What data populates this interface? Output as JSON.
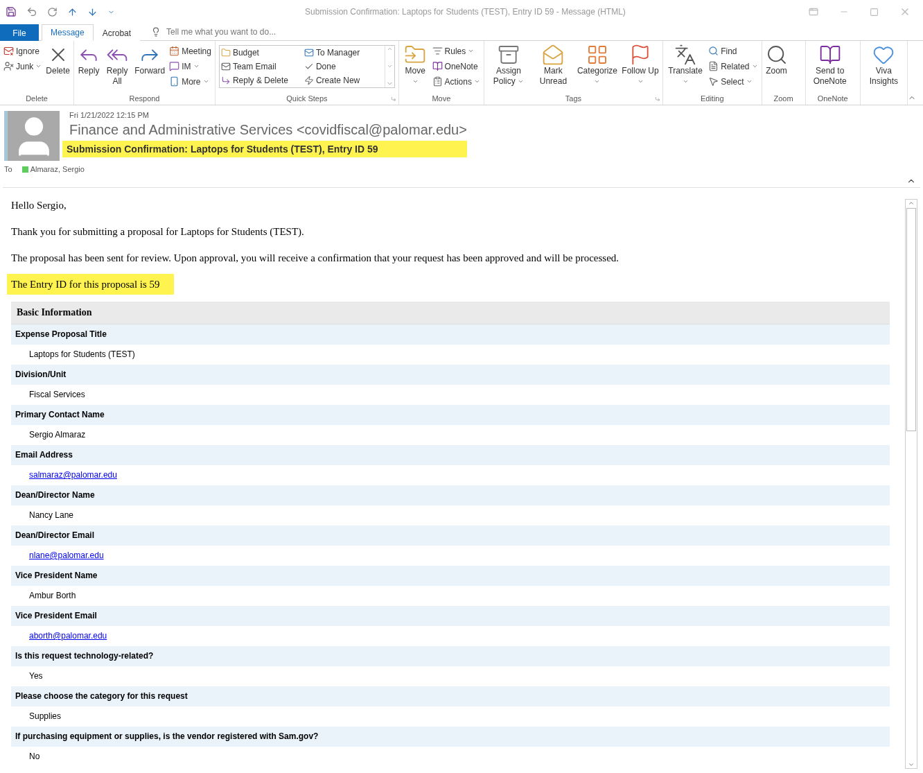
{
  "window": {
    "title": "Submission Confirmation: Laptops for Students (TEST), Entry ID 59 - Message (HTML)"
  },
  "tabs": [
    {
      "label": "File",
      "kind": "file",
      "selected": false
    },
    {
      "label": "Message",
      "kind": "tab",
      "selected": true
    },
    {
      "label": "Acrobat",
      "kind": "tab",
      "selected": false
    }
  ],
  "tell_me": {
    "placeholder": "Tell me what you want to do..."
  },
  "ribbon": {
    "groups": [
      {
        "label": "Delete",
        "launcher": false,
        "columns": [
          {
            "kind": "stack",
            "items": [
              {
                "label": "Ignore",
                "dropdown": false
              },
              {
                "label": "Junk",
                "dropdown": true
              }
            ]
          },
          {
            "kind": "large",
            "label": "Delete",
            "dropdown": false
          }
        ]
      },
      {
        "label": "Respond",
        "launcher": false,
        "columns": [
          {
            "kind": "large",
            "label": "Reply",
            "dropdown": false
          },
          {
            "kind": "large",
            "label": "Reply All",
            "dropdown": false
          },
          {
            "kind": "large",
            "label": "Forward",
            "dropdown": false
          },
          {
            "kind": "stack",
            "items": [
              {
                "label": "Meeting",
                "dropdown": false
              },
              {
                "label": "IM",
                "dropdown": true
              },
              {
                "label": "More",
                "dropdown": true
              }
            ]
          }
        ]
      },
      {
        "label": "Quick Steps",
        "launcher": true,
        "columns": [
          {
            "kind": "gallery",
            "items": [
              {
                "label": "Budget",
                "dropdown": false
              },
              {
                "label": "Team Email",
                "dropdown": false
              },
              {
                "label": "Reply & Delete",
                "dropdown": false
              },
              {
                "label": "To Manager",
                "dropdown": false
              },
              {
                "label": "Done",
                "dropdown": false
              },
              {
                "label": "Create New",
                "dropdown": false
              }
            ]
          }
        ]
      },
      {
        "label": "Move",
        "launcher": false,
        "columns": [
          {
            "kind": "large",
            "label": "Move",
            "dropdown": true
          },
          {
            "kind": "stack",
            "items": [
              {
                "label": "Rules",
                "dropdown": true
              },
              {
                "label": "OneNote",
                "dropdown": false
              },
              {
                "label": "Actions",
                "dropdown": true
              }
            ]
          }
        ]
      },
      {
        "label": "Tags",
        "launcher": true,
        "columns": [
          {
            "kind": "large",
            "label": "Assign Policy",
            "dropdown": true
          },
          {
            "kind": "large",
            "label": "Mark Unread",
            "dropdown": false
          },
          {
            "kind": "large",
            "label": "Categorize",
            "dropdown": true
          },
          {
            "kind": "large",
            "label": "Follow Up",
            "dropdown": true
          }
        ]
      },
      {
        "label": "Editing",
        "launcher": false,
        "columns": [
          {
            "kind": "large",
            "label": "Translate",
            "dropdown": true
          },
          {
            "kind": "stack",
            "items": [
              {
                "label": "Find",
                "dropdown": false
              },
              {
                "label": "Related",
                "dropdown": true
              },
              {
                "label": "Select",
                "dropdown": true
              }
            ]
          }
        ]
      },
      {
        "label": "Zoom",
        "launcher": false,
        "columns": [
          {
            "kind": "large",
            "label": "Zoom",
            "dropdown": false
          }
        ]
      },
      {
        "label": "OneNote",
        "launcher": false,
        "columns": [
          {
            "kind": "large",
            "label": "Send to OneNote",
            "dropdown": false
          }
        ]
      },
      {
        "launcher": false,
        "columns": [
          {
            "kind": "large",
            "label": "Viva Insights",
            "dropdown": false
          }
        ]
      }
    ]
  },
  "header": {
    "date": "Fri 1/21/2022 12:15 PM",
    "sender": "Finance and Administrative Services <covidfiscal@palomar.edu>",
    "subject": "Submission Confirmation: Laptops for Students (TEST), Entry ID 59",
    "to_label": "To",
    "recipients": [
      {
        "name": "Almaraz, Sergio",
        "color": "#5dce5d"
      }
    ]
  },
  "body": {
    "paragraphs": [
      "Hello Sergio,",
      "Thank you for submitting a proposal for Laptops for Students (TEST).",
      "The proposal has been sent for review. Upon approval, you will receive a confirmation that your request has been approved and will be processed."
    ],
    "highlight": "The Entry ID for this proposal is 59",
    "table": {
      "title": "Basic Information",
      "rows": [
        {
          "label": "Expense Proposal Title",
          "value": "Laptops for Students (TEST)",
          "kind": "text"
        },
        {
          "label": "Division/Unit",
          "value": "Fiscal Services",
          "kind": "text"
        },
        {
          "label": "Primary Contact Name",
          "value": "Sergio Almaraz",
          "kind": "text"
        },
        {
          "label": "Email Address",
          "value": "salmaraz@palomar.edu",
          "kind": "link"
        },
        {
          "label": "Dean/Director Name",
          "value": "Nancy Lane",
          "kind": "text"
        },
        {
          "label": "Dean/Director Email",
          "value": "nlane@palomar.edu",
          "kind": "link"
        },
        {
          "label": "Vice President Name",
          "value": "Ambur Borth",
          "kind": "text"
        },
        {
          "label": "Vice President Email",
          "value": "aborth@palomar.edu",
          "kind": "link"
        },
        {
          "label": "Is this request technology-related?",
          "value": "Yes",
          "kind": "text"
        },
        {
          "label": "Please choose the category for this request",
          "value": "Supplies",
          "kind": "text"
        },
        {
          "label": "If purchasing equipment or supplies, is the vendor registered with Sam.gov?",
          "value": "No",
          "kind": "text"
        }
      ]
    }
  }
}
